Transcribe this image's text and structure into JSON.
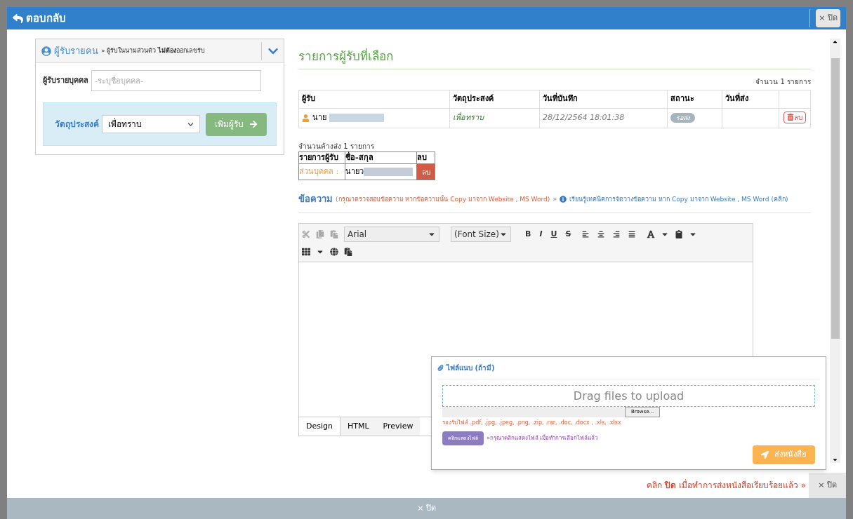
{
  "header": {
    "back_label": "ตอบกลับ",
    "close_label": "× ปิด"
  },
  "recipient_panel": {
    "title": "ผู้รับรายคน",
    "subtitle": "» ผู้รับในนามส่วนตัว **ไม่ต้อง**ออกเลขรับ",
    "expanded": true,
    "person_label": "ผู้รับรายบุคคล",
    "person_placeholder": "-ระบุชื่อบุคคล-",
    "purpose_label": "วัตถุประสงค์",
    "purpose_value": "เพื่อทราบ",
    "add_button": "เพิ่มผู้รับ"
  },
  "selected": {
    "title": "รายการผู้รับที่เลือก",
    "count": "จำนวน 1 รายการ",
    "columns": [
      "ผู้รับ",
      "วัตถุประสงค์",
      "วันที่บันทึก",
      "สถานะ",
      "วันที่ส่ง"
    ],
    "rows": [
      {
        "recipient": "นาย",
        "purpose": "เพื่อทราบ",
        "saved": "28/12/2564 18:01:38",
        "status": "รอส่ง",
        "sent": "",
        "delete": "ลบ"
      }
    ]
  },
  "pending": {
    "count": "จำนวนค้างส่ง 1 รายการ",
    "columns": [
      "รายการผู้รับ",
      "ชื่อ-สกุล",
      "ลบ"
    ],
    "rows": [
      {
        "type": "ส่วนบุคคล :",
        "name": "นายว",
        "delete": "ลบ"
      }
    ]
  },
  "message": {
    "label": "ข้อความ",
    "warning": "(กรุณาตรวจสอบข้อความ หากข้อความนั้น Copy มาจาก Website , MS Word)",
    "separator": "»",
    "help_link": "เรียนรู้เทคนิคการจัดวางข้อความ หาก Copy มาจาก Website , MS Word (คลิก)"
  },
  "editor": {
    "font": "Arial",
    "font_size": "(Font Size)",
    "toolbar": [
      "B",
      "I",
      "U",
      "S"
    ],
    "tabs": [
      {
        "label": "Design",
        "selected": true
      },
      {
        "label": "HTML",
        "selected": false
      },
      {
        "label": "Preview",
        "selected": false
      }
    ]
  },
  "attachment": {
    "title": "ไฟล์แนบ (ถ้ามี)",
    "drop_text": "Drag files to upload",
    "browse": "Browse...",
    "accepted": "รองรับไฟล์ .pdf, .jpg, .jpeg, .png, .zip, .rar, .doc, .docx , .xls, .xlsx",
    "show_button": "คลิกแสดงไฟล์",
    "show_hint": "«กรุณาคลิกแสดงไฟล์ เมื่อทำการเลือกไฟล์แล้ว",
    "send_button": "ส่งหนังสือ"
  },
  "footer_note": {
    "prefix": "คลิก",
    "bold": "ปิด",
    "suffix": "เมื่อทำการส่งหนังสือเรียบร้อยแล้ว »",
    "close": "× ปิด"
  },
  "footer_bar": {
    "close": "× ปิด"
  }
}
